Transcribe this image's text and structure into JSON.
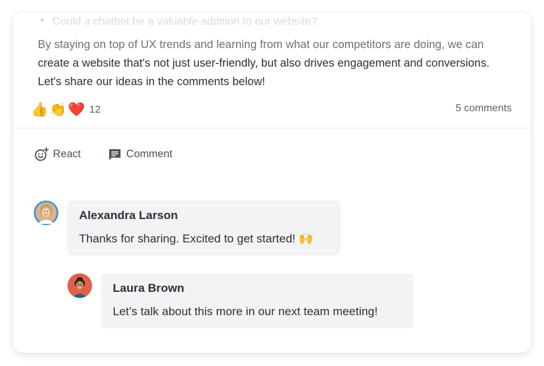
{
  "post": {
    "faded_bullet": "Could a chatbot be a valuable addition to our website?",
    "body_lines": [
      "By staying on top of UX trends and learning from what our competitors are doing, we can",
      "create a website that's not just user-friendly, but also drives engagement and conversions.",
      "Let's share our ideas in the comments below!"
    ],
    "reactions": {
      "emojis": [
        "👍",
        "👏",
        "❤️"
      ],
      "count": "12"
    },
    "comments_count": "5 comments"
  },
  "actions": {
    "react_label": "React",
    "comment_label": "Comment"
  },
  "comments": [
    {
      "author": "Alexandra Larson",
      "text": "Thanks for sharing. Excited to get started! 🙌"
    },
    {
      "author": "Laura Brown",
      "text": "Let’s talk about this more in our next team meeting!"
    }
  ],
  "colors": {
    "bubble_bg": "#f2f3f5",
    "avatar1_ring": "#3b8fd9",
    "avatar2_bg": "#e0604a"
  }
}
